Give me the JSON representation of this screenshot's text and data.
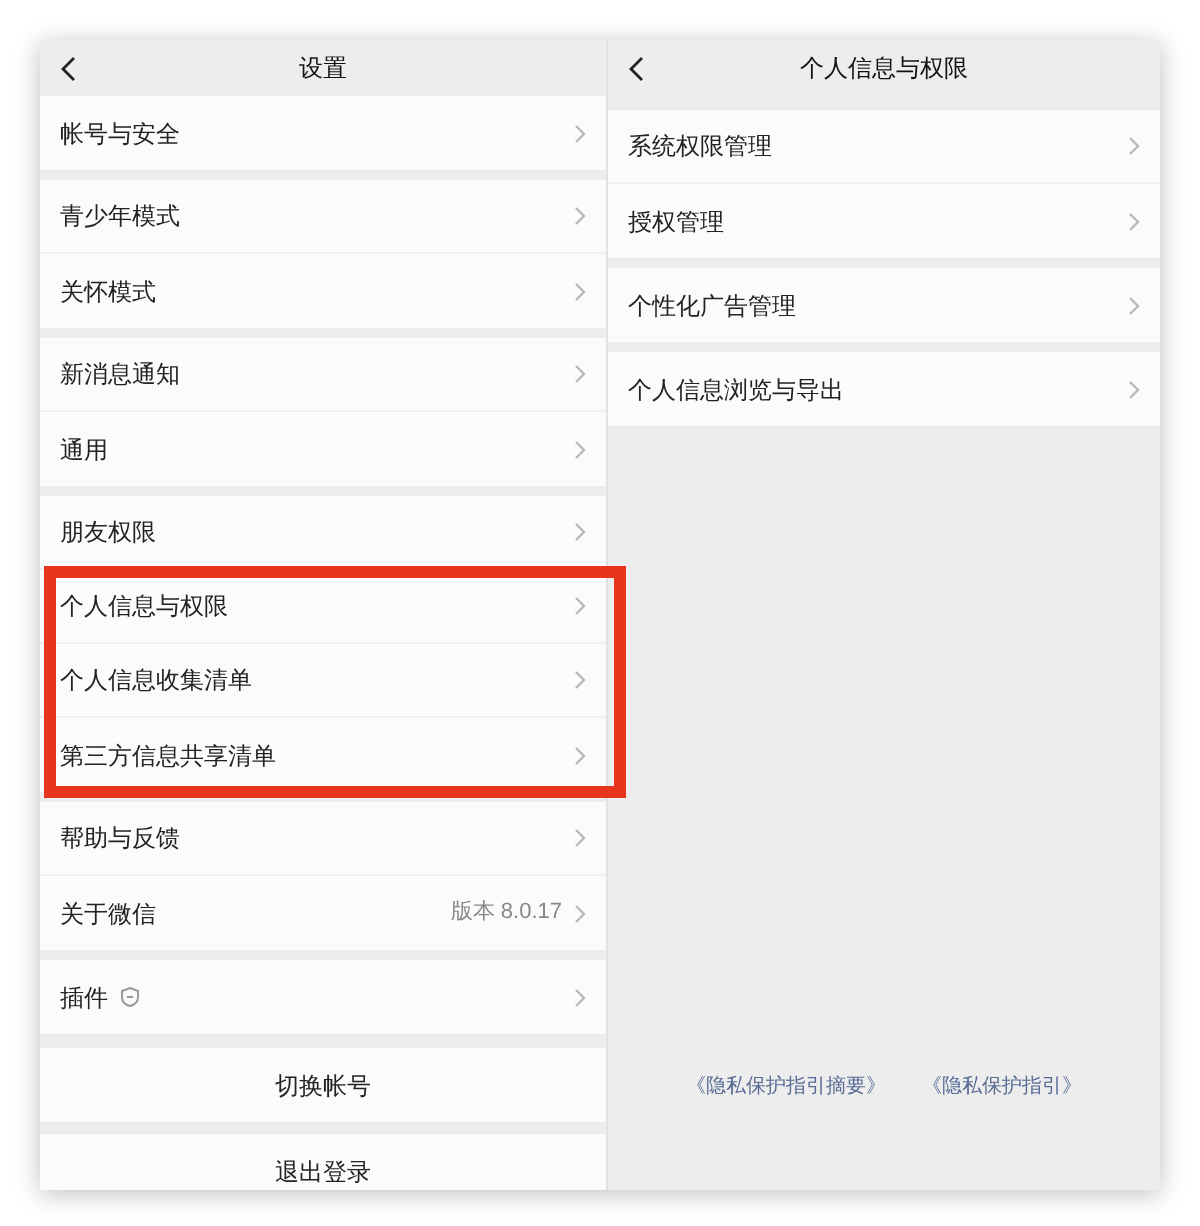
{
  "left": {
    "title": "设置",
    "groups": [
      {
        "rows": [
          {
            "label": "帐号与安全",
            "kind": "plain",
            "highlighted": false
          }
        ]
      },
      {
        "rows": [
          {
            "label": "青少年模式",
            "kind": "plain",
            "highlighted": false
          },
          {
            "label": "关怀模式",
            "kind": "plain",
            "highlighted": false
          }
        ]
      },
      {
        "rows": [
          {
            "label": "新消息通知",
            "kind": "plain",
            "highlighted": false
          },
          {
            "label": "通用",
            "kind": "plain",
            "highlighted": false
          }
        ]
      },
      {
        "rows": [
          {
            "label": "朋友权限",
            "kind": "plain",
            "highlighted": false
          },
          {
            "label": "个人信息与权限",
            "kind": "plain",
            "highlighted": true
          },
          {
            "label": "个人信息收集清单",
            "kind": "plain",
            "highlighted": true
          },
          {
            "label": "第三方信息共享清单",
            "kind": "plain",
            "highlighted": true
          }
        ]
      },
      {
        "rows": [
          {
            "label": "帮助与反馈",
            "kind": "plain",
            "highlighted": false
          },
          {
            "label": "关于微信",
            "kind": "value",
            "value": "版本 8.0.17",
            "highlighted": false
          }
        ]
      },
      {
        "rows": [
          {
            "label": "插件",
            "kind": "shield",
            "highlighted": false
          }
        ]
      }
    ],
    "buttons": [
      "切换帐号",
      "退出登录"
    ]
  },
  "right": {
    "title": "个人信息与权限",
    "groups": [
      {
        "rows": [
          {
            "label": "系统权限管理",
            "kind": "plain",
            "highlighted": false
          },
          {
            "label": "授权管理",
            "kind": "plain",
            "highlighted": false
          }
        ]
      },
      {
        "rows": [
          {
            "label": "个性化广告管理",
            "kind": "plain",
            "highlighted": false
          }
        ]
      },
      {
        "rows": [
          {
            "label": "个人信息浏览与导出",
            "kind": "plain",
            "highlighted": false
          }
        ]
      }
    ],
    "links": [
      "《隐私保护指引摘要》",
      "《隐私保护指引》"
    ]
  }
}
